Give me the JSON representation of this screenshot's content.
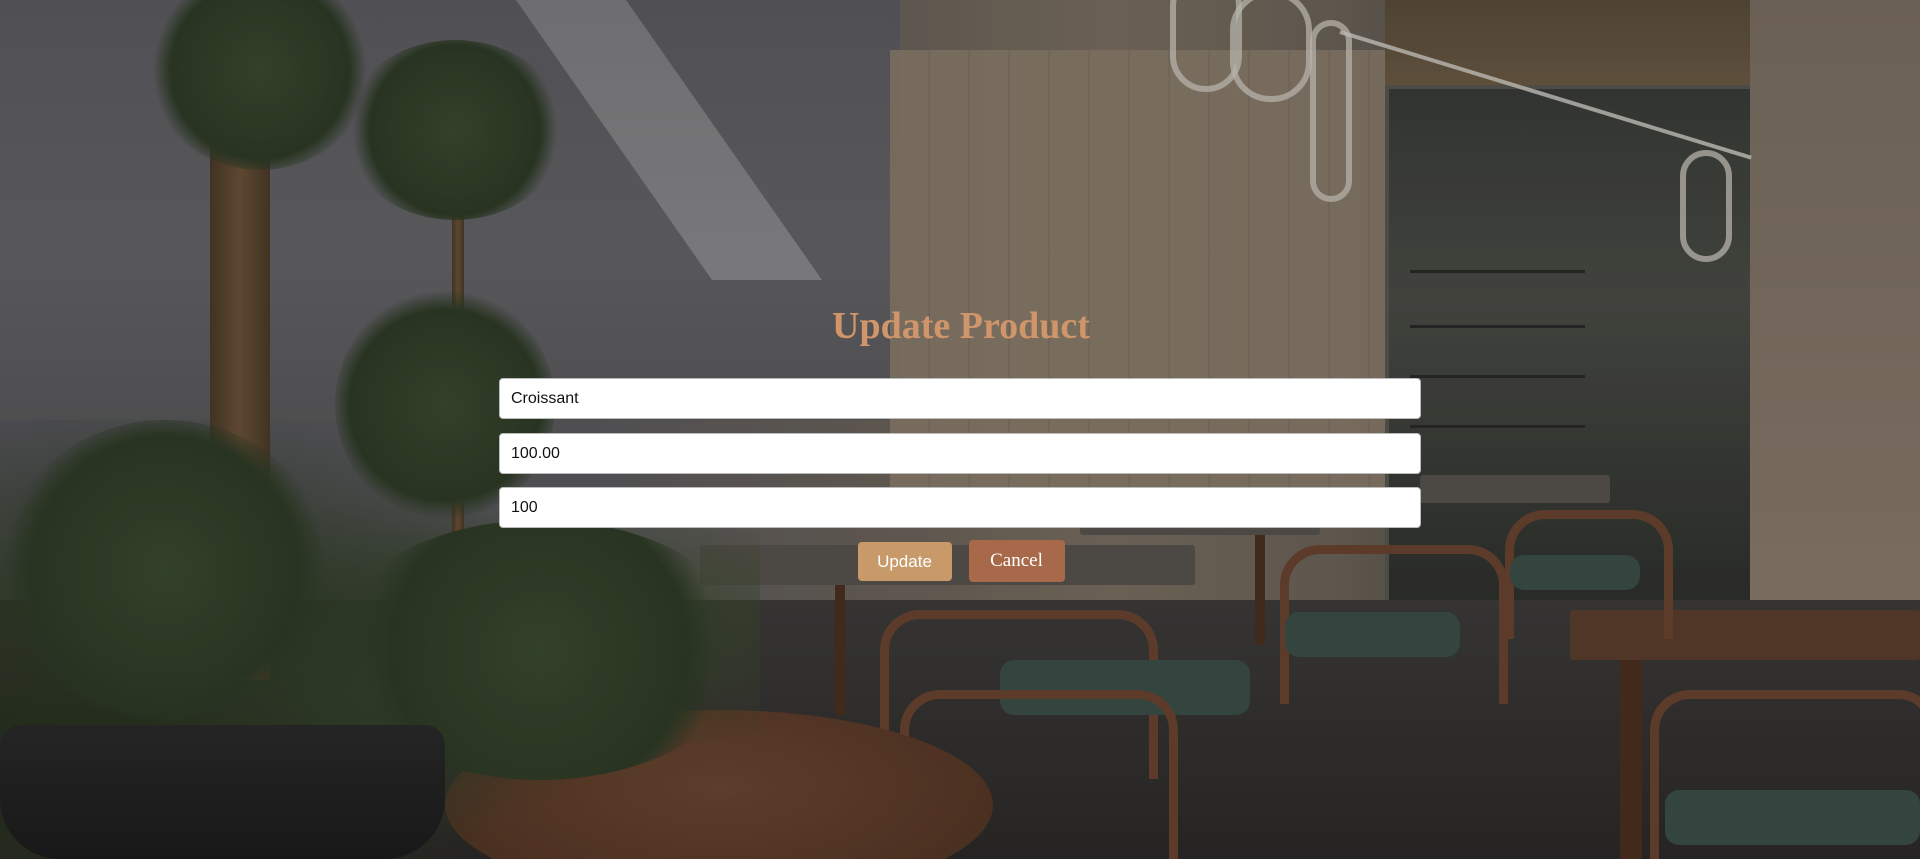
{
  "form": {
    "title": "Update Product",
    "name_value": "Croissant",
    "price_value": "100.00",
    "quantity_value": "100",
    "update_label": "Update",
    "cancel_label": "Cancel"
  },
  "colors": {
    "title": "#d0956a",
    "update_button": "#c89a6a",
    "cancel_button": "#a8694a"
  }
}
